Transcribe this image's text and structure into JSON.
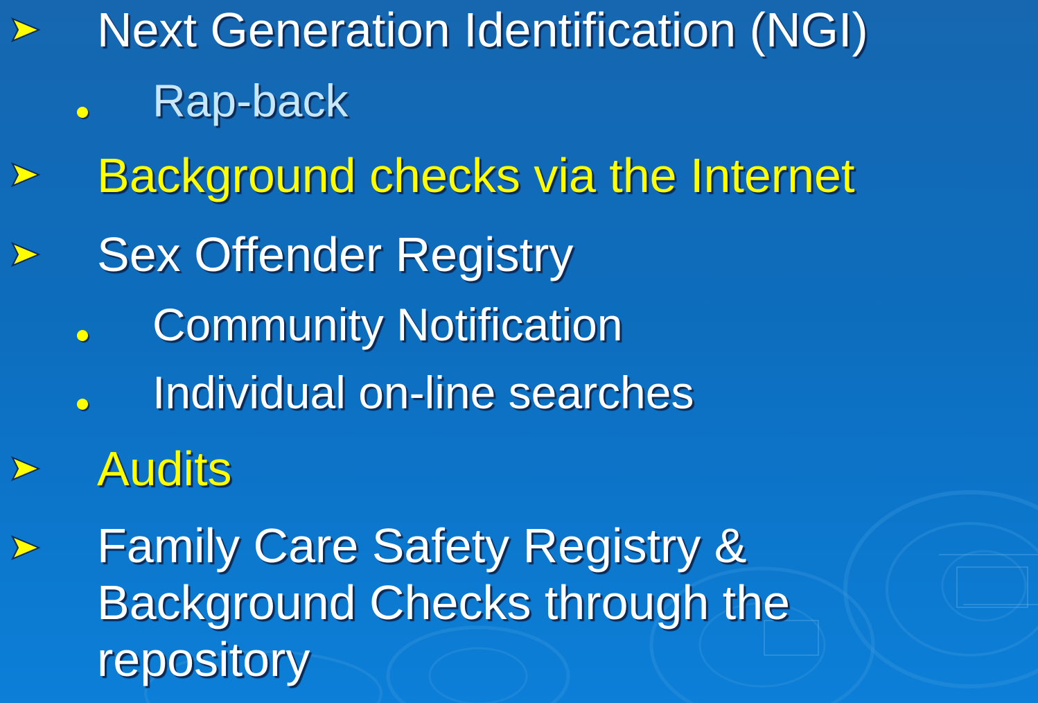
{
  "slide": {
    "accent_color": "#ffff00",
    "text_color": "#ffffff",
    "subtext_color": "#c7e6f7",
    "background_color": "#0d6dbd",
    "bullet_icon": "arrow-bullet-icon",
    "sub_bullet_icon": "dot-bullet-icon",
    "items": [
      {
        "text": "Next Generation Identification (NGI)"
      },
      {
        "text": "Rap-back"
      },
      {
        "text": "Background checks via the Internet"
      },
      {
        "text": "Sex Offender Registry"
      },
      {
        "text": "Community Notification"
      },
      {
        "text": "Individual on-line searches"
      },
      {
        "text": "Audits"
      },
      {
        "text": "Family Care Safety Registry & Background Checks through the repository"
      }
    ]
  }
}
